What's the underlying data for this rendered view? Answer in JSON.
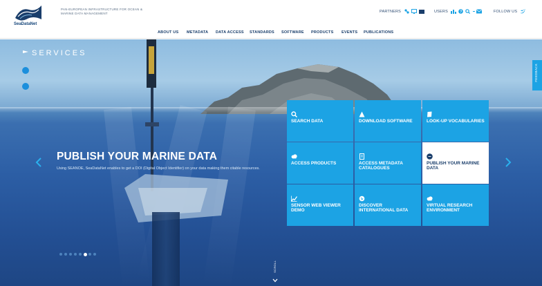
{
  "header": {
    "logo_text": "SeaDataNet",
    "tagline": "Pan-European infrastructure for ocean & marine data management",
    "partners_label": "PARTNERS",
    "users_label": "USERS",
    "follow_label": "FOLLOW US"
  },
  "nav": {
    "items": [
      {
        "label": "ABOUT US"
      },
      {
        "label": "METADATA"
      },
      {
        "label": "DATA ACCESS"
      },
      {
        "label": "STANDARDS"
      },
      {
        "label": "SOFTWARE"
      },
      {
        "label": "PRODUCTS"
      },
      {
        "label": "EVENTS"
      },
      {
        "label": "PUBLICATIONS"
      }
    ]
  },
  "hero": {
    "section_title": "SERVICES",
    "heading": "PUBLISH YOUR MARINE DATA",
    "description": "Using SEANOE, SeaDataNet enables to get a DOI (Digital Object Identifier) on your data making them citable resources.",
    "feedback_label": "FEEDBACK",
    "scroll_label": "SCROLL",
    "carousel_index": 5,
    "carousel_count": 8
  },
  "services": [
    {
      "label": "SEARCH DATA",
      "icon": "search-icon"
    },
    {
      "label": "DOWNLOAD SOFTWARE",
      "icon": "download-icon"
    },
    {
      "label": "LOOK-UP VOCABULARIES",
      "icon": "book-icon"
    },
    {
      "label": "ACCESS PRODUCTS",
      "icon": "cloud-icon"
    },
    {
      "label": "ACCESS METADATA CATALOGUES",
      "icon": "document-icon"
    },
    {
      "label": "PUBLISH YOUR MARINE DATA",
      "icon": "doi-icon",
      "selected": true
    },
    {
      "label": "SENSOR WEB VIEWER DEMO",
      "icon": "chart-icon"
    },
    {
      "label": "DISCOVER INTERNATIONAL DATA",
      "icon": "globe-icon"
    },
    {
      "label": "VIRTUAL RESEARCH ENVIRONMENT",
      "icon": "cloud-icon"
    }
  ],
  "colors": {
    "accent": "#1ca3e4",
    "brand": "#1a3e6b",
    "tile_selected": "#ffffff"
  }
}
